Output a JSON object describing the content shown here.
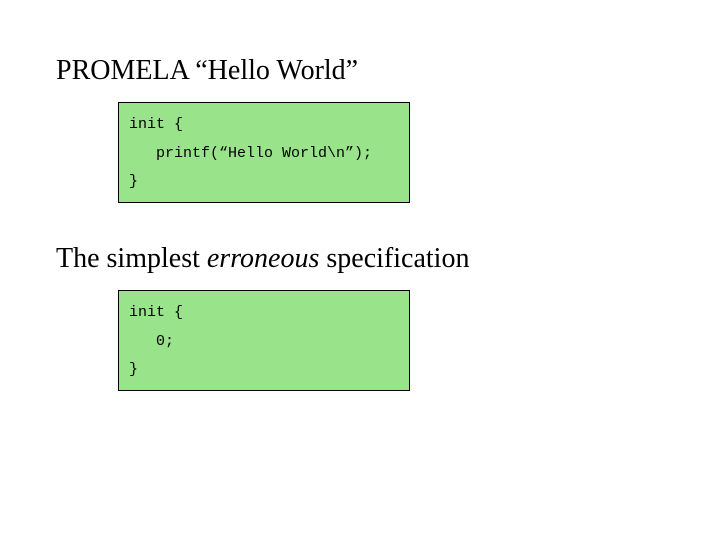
{
  "heading": "PROMELA “Hello World”",
  "code1": {
    "line1": "init {",
    "line2": "   printf(“Hello World\\n”);",
    "line3": "}"
  },
  "sub": {
    "part1": "The simplest ",
    "italic": "erroneous",
    "part2": " specification"
  },
  "code2": {
    "line1": "init {",
    "line2": "   0;",
    "line3": "}"
  }
}
